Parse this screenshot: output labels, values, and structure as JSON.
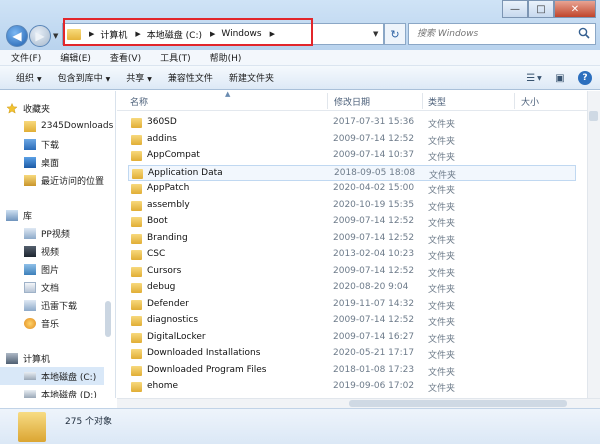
{
  "address": {
    "crumbs": [
      "计算机",
      "本地磁盘 (C:)",
      "Windows"
    ],
    "search_placeholder": "搜索 Windows"
  },
  "window_buttons": [
    "—",
    "□",
    "✕"
  ],
  "menubar": [
    "文件(F)",
    "编辑(E)",
    "查看(V)",
    "工具(T)",
    "帮助(H)"
  ],
  "toolbar": {
    "organize": "组织",
    "include_library": "包含到库中",
    "share": "共享",
    "compatibility": "兼容性文件",
    "new_folder": "新建文件夹"
  },
  "nav": {
    "favorites": "收藏夹",
    "fav_items": [
      "2345Downloads",
      "下载",
      "桌面",
      "最近访问的位置"
    ],
    "libraries": "库",
    "lib_items": [
      "PP视频",
      "视频",
      "图片",
      "文档",
      "迅雷下载",
      "音乐"
    ],
    "computer": "计算机",
    "drives": [
      "本地磁盘 (C:)",
      "本地磁盘 (D:)"
    ]
  },
  "columns": [
    "名称",
    "修改日期",
    "类型",
    "大小"
  ],
  "files": [
    {
      "name": "360SD",
      "date": "2017-07-31 15:36",
      "type": "文件夹"
    },
    {
      "name": "addins",
      "date": "2009-07-14 12:52",
      "type": "文件夹"
    },
    {
      "name": "AppCompat",
      "date": "2009-07-14 10:37",
      "type": "文件夹"
    },
    {
      "name": "Application Data",
      "date": "2018-09-05 18:08",
      "type": "文件夹"
    },
    {
      "name": "AppPatch",
      "date": "2020-04-02 15:00",
      "type": "文件夹"
    },
    {
      "name": "assembly",
      "date": "2020-10-19 15:35",
      "type": "文件夹"
    },
    {
      "name": "Boot",
      "date": "2009-07-14 12:52",
      "type": "文件夹"
    },
    {
      "name": "Branding",
      "date": "2009-07-14 12:52",
      "type": "文件夹"
    },
    {
      "name": "CSC",
      "date": "2013-02-04 10:23",
      "type": "文件夹"
    },
    {
      "name": "Cursors",
      "date": "2009-07-14 12:52",
      "type": "文件夹"
    },
    {
      "name": "debug",
      "date": "2020-08-20 9:04",
      "type": "文件夹"
    },
    {
      "name": "Defender",
      "date": "2019-11-07 14:32",
      "type": "文件夹"
    },
    {
      "name": "diagnostics",
      "date": "2009-07-14 12:52",
      "type": "文件夹"
    },
    {
      "name": "DigitalLocker",
      "date": "2009-07-14 16:27",
      "type": "文件夹"
    },
    {
      "name": "Downloaded Installations",
      "date": "2020-05-21 17:17",
      "type": "文件夹"
    },
    {
      "name": "Downloaded Program Files",
      "date": "2018-01-08 17:23",
      "type": "文件夹"
    },
    {
      "name": "ehome",
      "date": "2019-09-06 17:02",
      "type": "文件夹"
    }
  ],
  "status": "275 个对象"
}
